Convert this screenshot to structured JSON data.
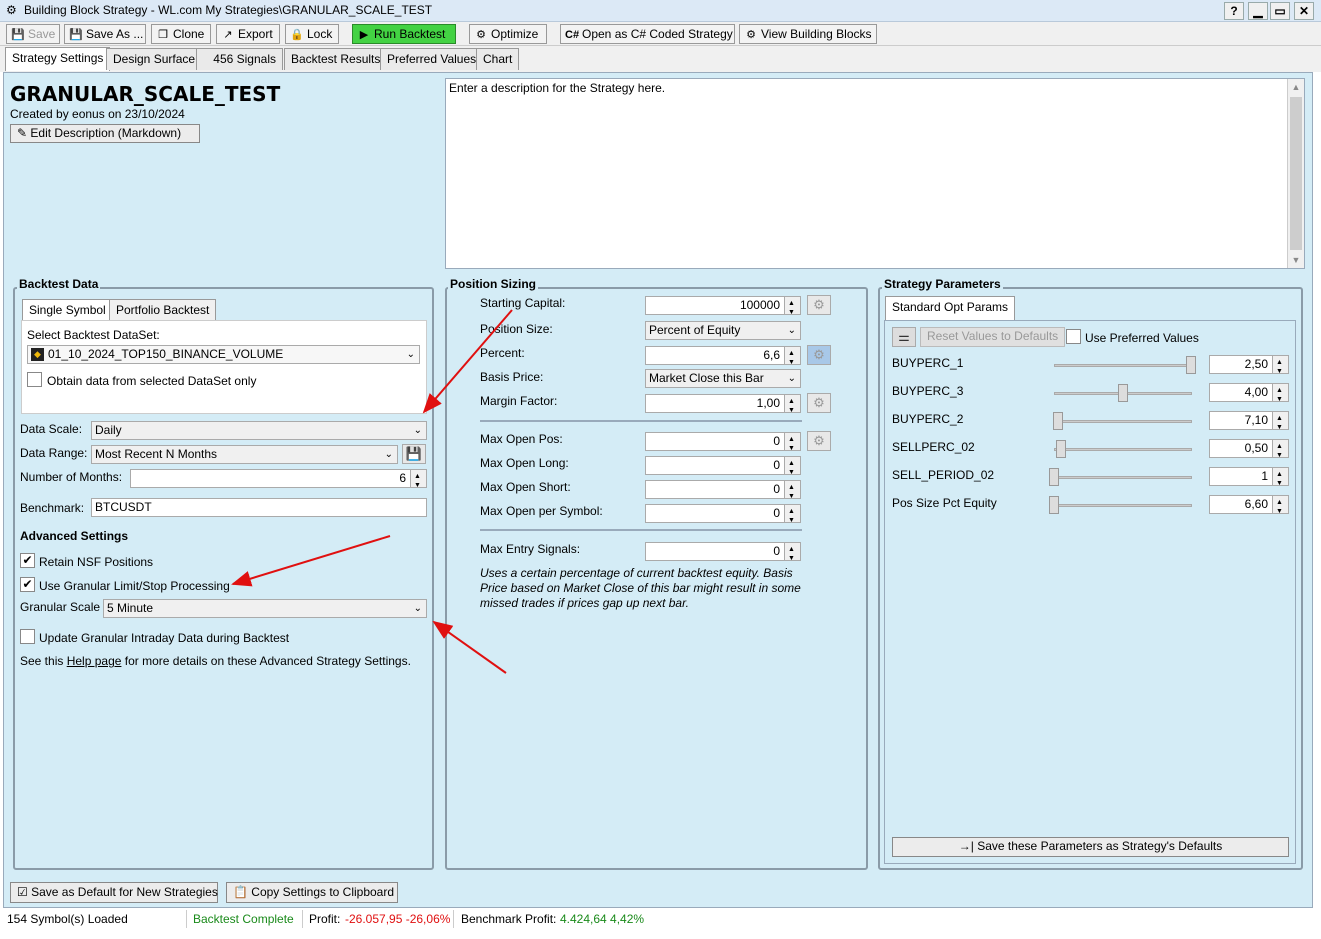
{
  "window": {
    "title": "Building Block Strategy - WL.com My Strategies\\GRANULAR_SCALE_TEST",
    "help": "?",
    "minimize": "▁",
    "maximize": "▭",
    "close": "✕"
  },
  "toolbar": {
    "save": "Save",
    "save_as": "Save As ...",
    "clone": "Clone",
    "export": "Export",
    "lock": "Lock",
    "run": "Run Backtest",
    "optimize": "Optimize",
    "open_csharp": "Open as C# Coded Strategy",
    "view_blocks": "View Building Blocks"
  },
  "tabs": [
    "Strategy Settings",
    "Design Surface",
    "456 Signals",
    "Backtest Results",
    "Preferred Values",
    "Chart"
  ],
  "strategy": {
    "name": "GRANULAR_SCALE_TEST",
    "created": "Created by eonus on 23/10/2024",
    "edit_desc": "Edit Description (Markdown)",
    "description": "Enter a description for the Strategy here."
  },
  "backtest_data": {
    "title": "Backtest Data",
    "tab_single": "Single Symbol",
    "tab_portfolio": "Portfolio Backtest",
    "dataset_label": "Select Backtest DataSet:",
    "dataset": "01_10_2024_TOP150_BINANCE_VOLUME",
    "obtain_only": "Obtain data from selected DataSet only",
    "data_scale_label": "Data Scale:",
    "data_scale": "Daily",
    "data_range_label": "Data Range:",
    "data_range": "Most Recent N Months",
    "num_months_label": "Number of Months:",
    "num_months": "6",
    "benchmark_label": "Benchmark:",
    "benchmark": "BTCUSDT",
    "advanced_title": "Advanced Settings",
    "retain_nsf": "Retain NSF Positions",
    "use_granular": "Use Granular Limit/Stop Processing",
    "granular_scale_label": "Granular Scale",
    "granular_scale": "5 Minute",
    "update_granular": "Update Granular Intraday Data during Backtest",
    "see_this": "See this",
    "help_page": "Help page",
    "see_rest": "for more details on these Advanced Strategy Settings."
  },
  "position_sizing": {
    "title": "Position Sizing",
    "starting_capital_label": "Starting Capital:",
    "starting_capital": "100000",
    "position_size_label": "Position Size:",
    "position_size": "Percent of Equity",
    "percent_label": "Percent:",
    "percent": "6,6",
    "basis_price_label": "Basis Price:",
    "basis_price": "Market Close this Bar",
    "margin_label": "Margin Factor:",
    "margin": "1,00",
    "max_open_pos_label": "Max Open Pos:",
    "max_open_pos": "0",
    "max_open_long_label": "Max Open Long:",
    "max_open_long": "0",
    "max_open_short_label": "Max Open Short:",
    "max_open_short": "0",
    "max_open_symbol_label": "Max Open per Symbol:",
    "max_open_symbol": "0",
    "max_entry_label": "Max Entry Signals:",
    "max_entry": "0",
    "note_1": "Uses a certain percentage of current backtest equity. Basis",
    "note_2": "Price based on Market Close of this bar might result in some",
    "note_3": "missed trades if prices gap up next bar."
  },
  "strategy_params": {
    "title": "Strategy Parameters",
    "tab": "Standard Opt Params",
    "reset": "Reset Values to Defaults",
    "use_preferred": "Use Preferred Values",
    "params": [
      {
        "name": "BUYPERC_1",
        "value": "2,50",
        "level": 1.0
      },
      {
        "name": "BUYPERC_3",
        "value": "4,00",
        "level": 0.5
      },
      {
        "name": "BUYPERC_2",
        "value": "7,10",
        "level": 0.03
      },
      {
        "name": "SELLPERC_02",
        "value": "0,50",
        "level": 0.05
      },
      {
        "name": "SELL_PERIOD_02",
        "value": "1",
        "level": 0.0
      },
      {
        "name": "Pos Size Pct Equity",
        "value": "6,60",
        "level": 0.0
      }
    ],
    "save_defaults": "Save these Parameters as Strategy's Defaults"
  },
  "footer": {
    "save_default": "Save as Default for New Strategies",
    "copy_settings": "Copy Settings to Clipboard"
  },
  "status": {
    "symbols": "154 Symbol(s) Loaded",
    "backtest": "Backtest Complete",
    "profit_label": "Profit:",
    "profit": "-26.057,95 -26,06%",
    "bench_label": "Benchmark Profit:",
    "bench": "4.424,64 4,42%"
  },
  "colors": {
    "panel": "#d4ecf6",
    "run_button": "#43d243",
    "arrow": "#e01010",
    "profit_negative": "#e01010",
    "profit_positive": "#1a8a1a"
  }
}
